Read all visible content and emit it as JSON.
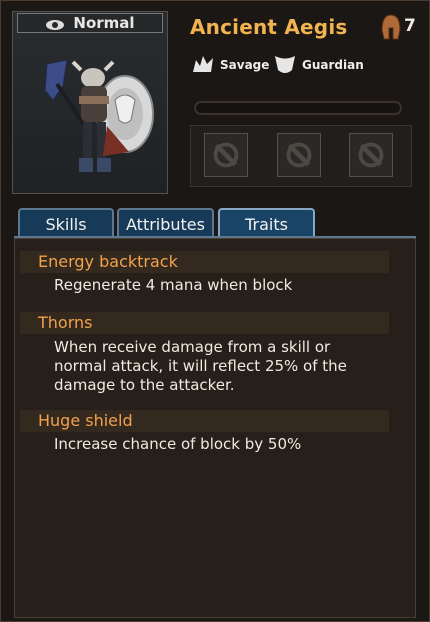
{
  "hero": {
    "rarity": "Normal",
    "name": "Ancient Aegis",
    "level": "7",
    "tags": [
      {
        "label": "Savage",
        "icon": "savage-beast-icon"
      },
      {
        "label": "Guardian",
        "icon": "guardian-shield-icon"
      }
    ],
    "exp_progress": 0
  },
  "equipment_slots": [
    "empty",
    "empty",
    "empty"
  ],
  "tabs": [
    {
      "label": "Skills",
      "active": false
    },
    {
      "label": "Attributes",
      "active": false
    },
    {
      "label": "Traits",
      "active": true
    }
  ],
  "traits": [
    {
      "title": "Energy backtrack",
      "description": "Regenerate 4 mana when block"
    },
    {
      "title": "Thorns",
      "description_lines": [
        "When receive damage from a skill or",
        "normal attack, it will reflect 25% of the",
        "damage to the attacker."
      ]
    },
    {
      "title": "Huge shield",
      "description": "Increase chance of block by 50%"
    }
  ],
  "colors": {
    "name": "#f1b450",
    "trait_title": "#f4a04c",
    "tab_blue": "#163a57"
  }
}
